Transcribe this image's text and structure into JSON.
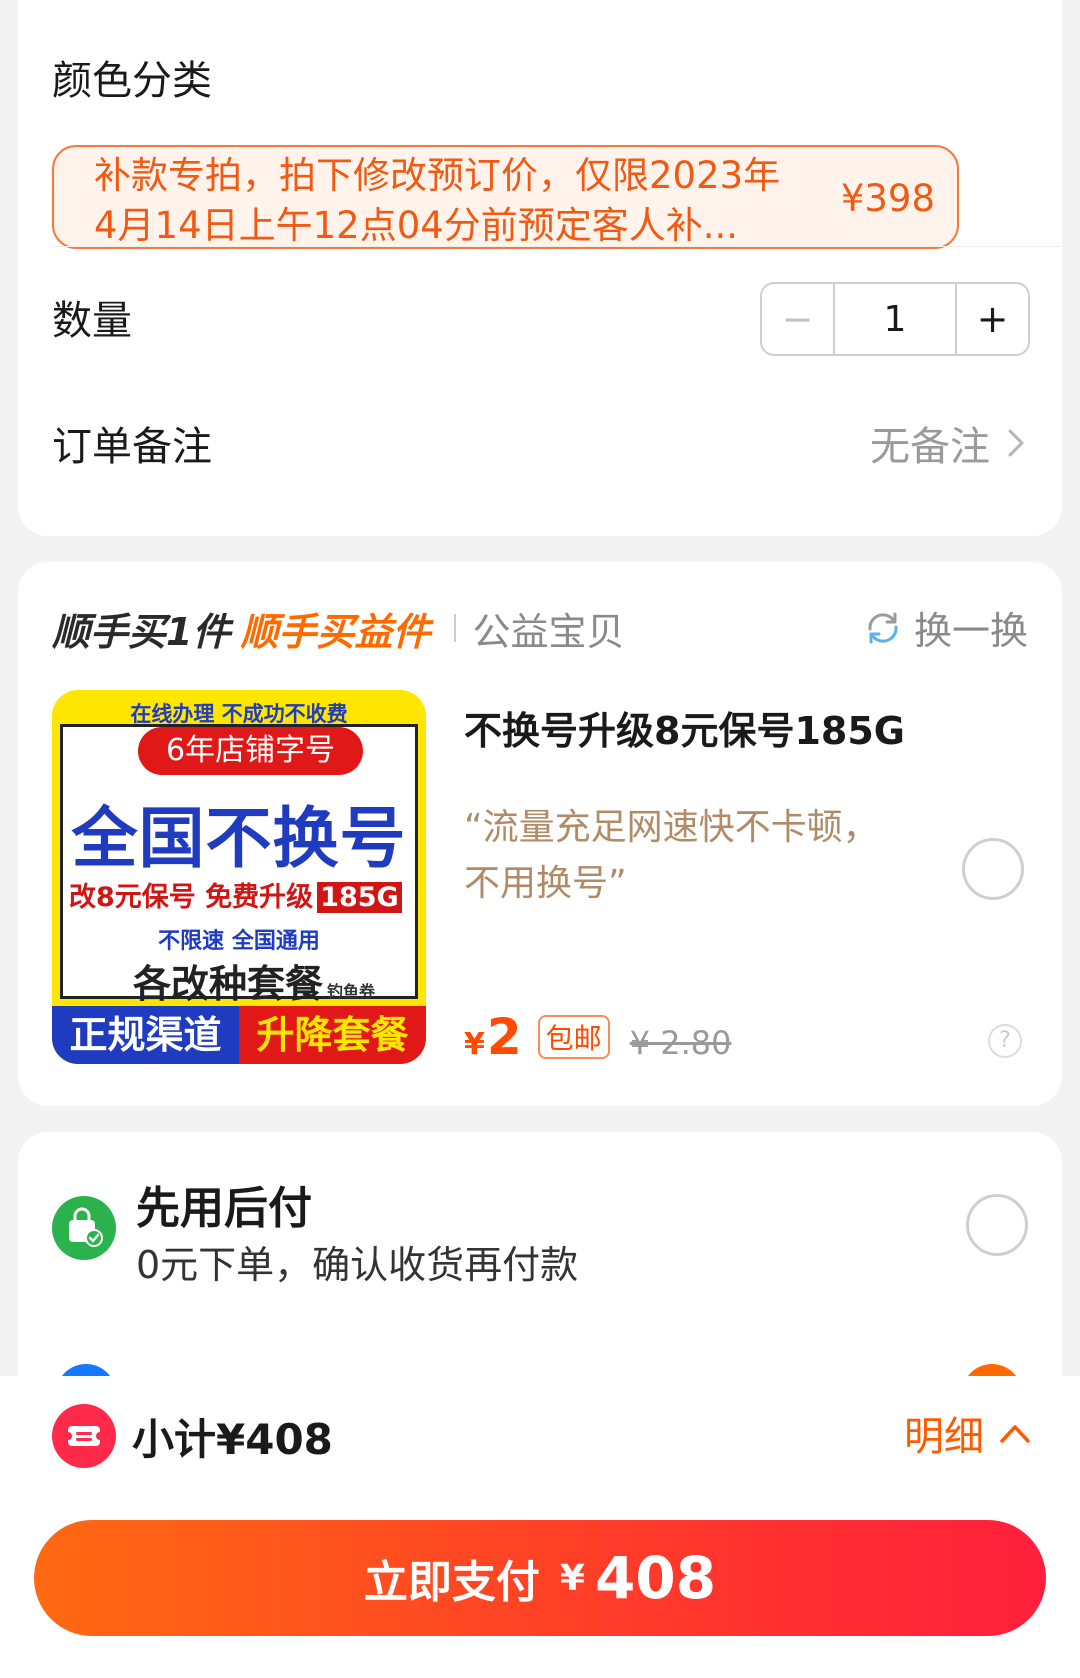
{
  "spec": {
    "color_label": "颜色分类",
    "variant_text": "补款专拍，拍下修改预订价，仅限2023年4月14日上午12点04分前预定客人补...",
    "variant_price": "¥398",
    "quantity_label": "数量",
    "quantity_minus": "−",
    "quantity_value": "1",
    "quantity_plus": "+",
    "remark_label": "订单备注",
    "remark_value": "无备注"
  },
  "addon": {
    "title": "顺手买1件",
    "title_highlight": "顺手买益件",
    "subtitle": "公益宝贝",
    "swap_label": "换一换",
    "product_name": "不换号升级8元保号185G",
    "product_quote": "“流量充足网速快不卡顿，不用换号”",
    "price_symbol": "¥",
    "price": "2",
    "ship_tag": "包邮",
    "original_price": "¥ 2.80",
    "help_symbol": "?",
    "image": {
      "top_line": "在线办理 不成功不收费",
      "pill": "6年店铺字号",
      "headline": "全国不换号",
      "line3": "改8元保号 免费升级",
      "line3_badge": "185G",
      "line4": "不限速 全国通用",
      "line5": "各改种套餐",
      "line5_tag": "钓鱼券",
      "bottom_left": "正规渠道",
      "bottom_right": "升降套餐"
    }
  },
  "payment": {
    "title": "先用后付",
    "subtitle": "0元下单，确认收货再付款"
  },
  "footer": {
    "subtotal": "小计¥408",
    "detail_label": "明细",
    "pay_label": "立即支付",
    "pay_symbol": "¥",
    "pay_amount": "408"
  },
  "colors": {
    "accent": "#ff6a00",
    "price": "#ff4a00",
    "variant_border": "#f5793b",
    "variant_text": "#f05a12",
    "quote": "#b08b66"
  }
}
